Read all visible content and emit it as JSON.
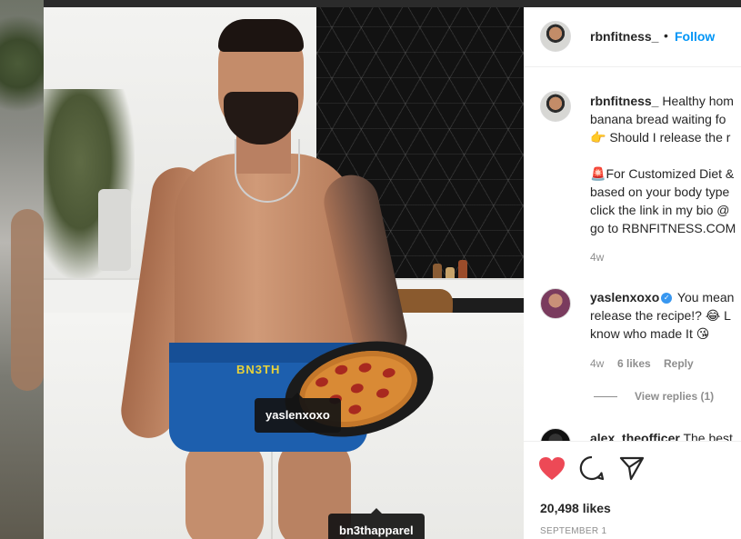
{
  "photo_tags": {
    "tag1": "yaslenxoxo",
    "tag2": "bn3thapparel",
    "shorts_brand": "BN3TH"
  },
  "post": {
    "header": {
      "username": "rbnfitness_",
      "separator": "•",
      "follow_label": "Follow"
    },
    "caption": {
      "username": "rbnfitness_",
      "line1": "Healthy hom",
      "line2": "banana bread waiting fo",
      "line3": "Should I release the r",
      "line4": "For Customized Diet &",
      "line5": "based on your body type",
      "line6": "click the link in my bio @",
      "line7": "go to RBNFITNESS.COM",
      "time": "4w",
      "emoji1": "👉",
      "emoji2": "🚨"
    },
    "comment1": {
      "username": "yaslenxoxo",
      "line1": "You mean",
      "line2": "release the recipe!? 😂 L",
      "line3": "know who made It 😘",
      "time": "4w",
      "likes": "6 likes",
      "reply_label": "Reply",
      "view_replies": "View replies (1)"
    },
    "comment2": {
      "username": "alex_theofficer",
      "text": "The best"
    },
    "actions": {
      "likes_count": "20,498 likes",
      "date": "SEPTEMBER 1"
    }
  },
  "colors": {
    "like_heart": "#ed4956",
    "follow_blue": "#0095f6",
    "verified_blue": "#3897f0"
  },
  "icons": {
    "like": "heart-icon",
    "comment": "comment-bubble-icon",
    "share": "paper-plane-icon",
    "verified": "verified-badge-icon"
  }
}
